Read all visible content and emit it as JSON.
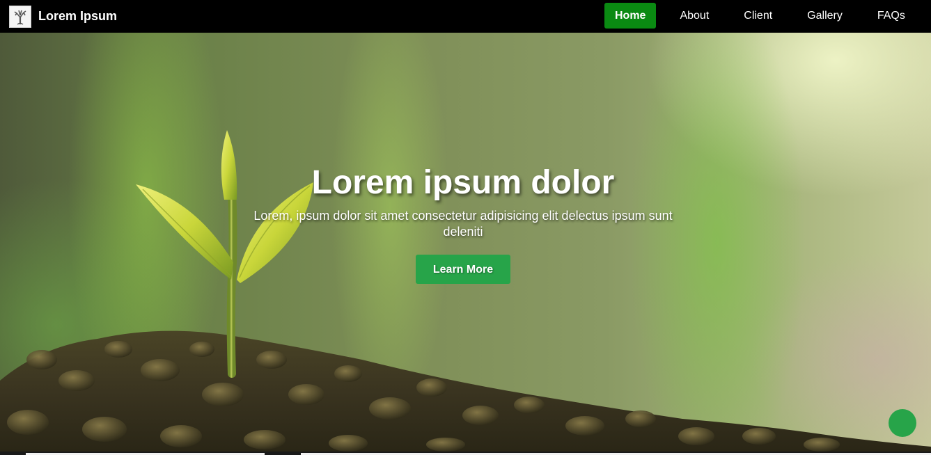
{
  "navbar": {
    "brand_name": "Lorem Ipsum",
    "logo_icon": "tree-logo-icon",
    "links": [
      {
        "label": "Home",
        "active": true
      },
      {
        "label": "About",
        "active": false
      },
      {
        "label": "Client",
        "active": false
      },
      {
        "label": "Gallery",
        "active": false
      },
      {
        "label": "FAQs",
        "active": false
      }
    ]
  },
  "hero": {
    "title": "Lorem ipsum dolor",
    "subtitle_line1": "Lorem, ipsum dolor sit amet consectetur adipisicing elit delectus ipsum sunt",
    "subtitle_line2": "deleniti",
    "button_label": "Learn More",
    "background_image": "plant-sprout-in-soil"
  },
  "floating_button": {
    "icon": "circle-button"
  },
  "colors": {
    "nav_background": "#000000",
    "active_link": "#0a8a12",
    "accent_green": "#27a449",
    "text": "#ffffff"
  }
}
